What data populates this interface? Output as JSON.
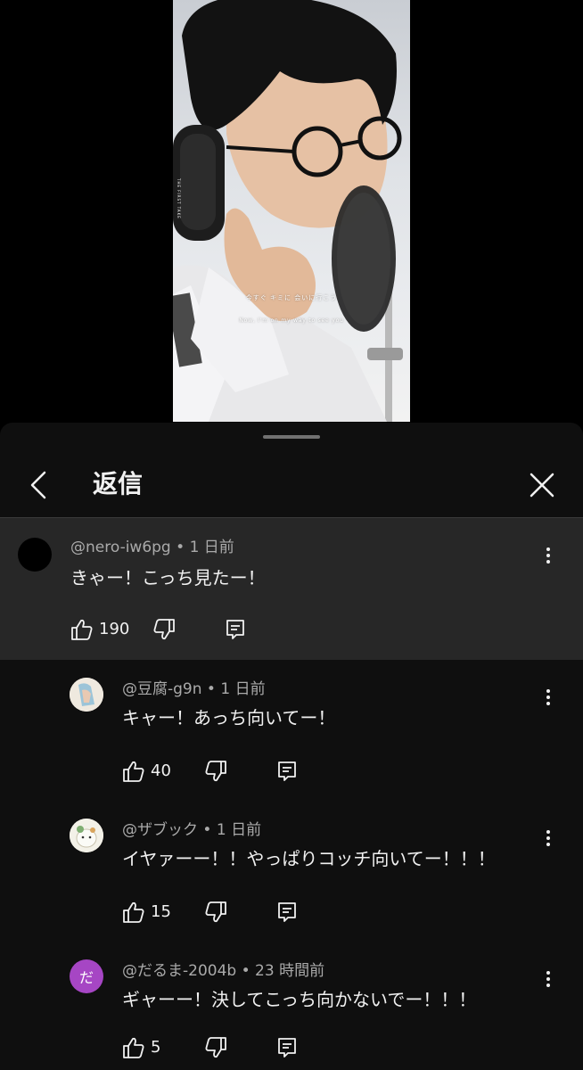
{
  "video": {
    "caption_jp": "今すぐ キミに 会いに行こう",
    "caption_en": "Now, I'm on my way to see you",
    "side_text": "THE FIRST TAKE"
  },
  "sheet": {
    "title": "返信",
    "back_icon": "chevron-left-icon",
    "close_icon": "close-icon"
  },
  "parent_comment": {
    "author": "@nero-iw6pg",
    "time": "1 日前",
    "text": "きゃー！こっち見たー！",
    "likes": "190"
  },
  "replies": [
    {
      "author": "@豆腐-g9n",
      "time": "1 日前",
      "text": "キャー！あっち向いてー！",
      "likes": "40"
    },
    {
      "author": "@ザブック",
      "time": "1 日前",
      "text": "イヤァーー！！やっぱりコッチ向いてー！！！",
      "likes": "15"
    },
    {
      "author": "@だるま-2004b",
      "time": "23 時間前",
      "text": "ギャーー！決してこっち向かないでー！！！",
      "likes": "5",
      "avatar_letter": "だ"
    }
  ],
  "colors": {
    "sheet_bg": "#0f0f0f",
    "parent_bg": "#272727",
    "avatar_purple": "#a646c4"
  }
}
